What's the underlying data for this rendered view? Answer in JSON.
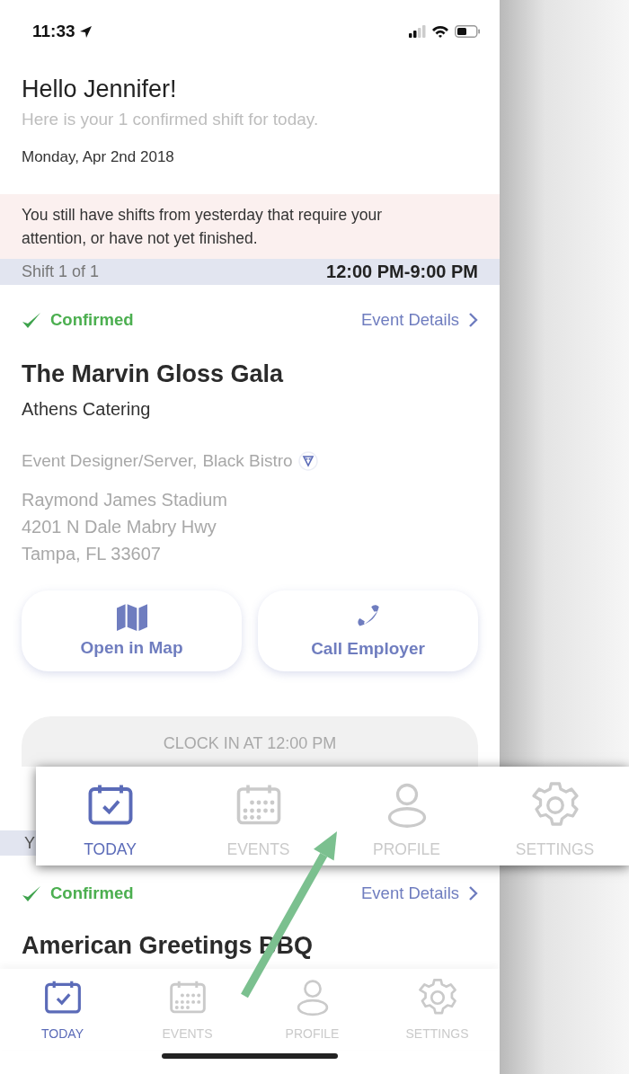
{
  "status_bar": {
    "time": "11:33"
  },
  "greeting": {
    "title": "Hello Jennifer!",
    "subtitle": "Here is your 1 confirmed shift for today.",
    "date": "Monday, Apr 2nd 2018"
  },
  "alert": {
    "text": "You still have shifts from yesterday that require your attention, or have not yet finished."
  },
  "shifts": [
    {
      "header": "Shift 1 of 1",
      "time": "12:00 PM-9:00 PM",
      "status": "Confirmed",
      "details_link": "Event Details",
      "title": "The Marvin Gloss Gala",
      "company": "Athens Catering",
      "role": "Event Designer/Server,",
      "uniform": "Black Bistro",
      "address": [
        "Raymond James Stadium",
        "4201 N Dale Mabry Hwy",
        "Tampa, FL 33607"
      ],
      "actions": [
        {
          "kind": "map",
          "label": "Open in Map"
        },
        {
          "kind": "phone",
          "label": "Call Employer"
        }
      ],
      "clock_in": {
        "label": "CLOCK IN AT 12:00 PM",
        "disabled": true
      }
    },
    {
      "header": "Y",
      "status": "Confirmed",
      "details_link": "Event Details",
      "title": "American Greetings BBQ"
    }
  ],
  "tab_bar": [
    {
      "kind": "today",
      "label": "TODAY",
      "selected": true
    },
    {
      "kind": "events",
      "label": "EVENTS",
      "selected": false
    },
    {
      "kind": "profile",
      "label": "PROFILE",
      "selected": false
    },
    {
      "kind": "settings",
      "label": "SETTINGS",
      "selected": false
    }
  ],
  "callout": {
    "tabs": [
      {
        "kind": "today",
        "label": "TODAY",
        "selected": true
      },
      {
        "kind": "events",
        "label": "EVENTS",
        "selected": false
      },
      {
        "kind": "profile",
        "label": "PROFILE",
        "selected": false
      },
      {
        "kind": "settings",
        "label": "SETTINGS",
        "selected": false
      }
    ]
  }
}
